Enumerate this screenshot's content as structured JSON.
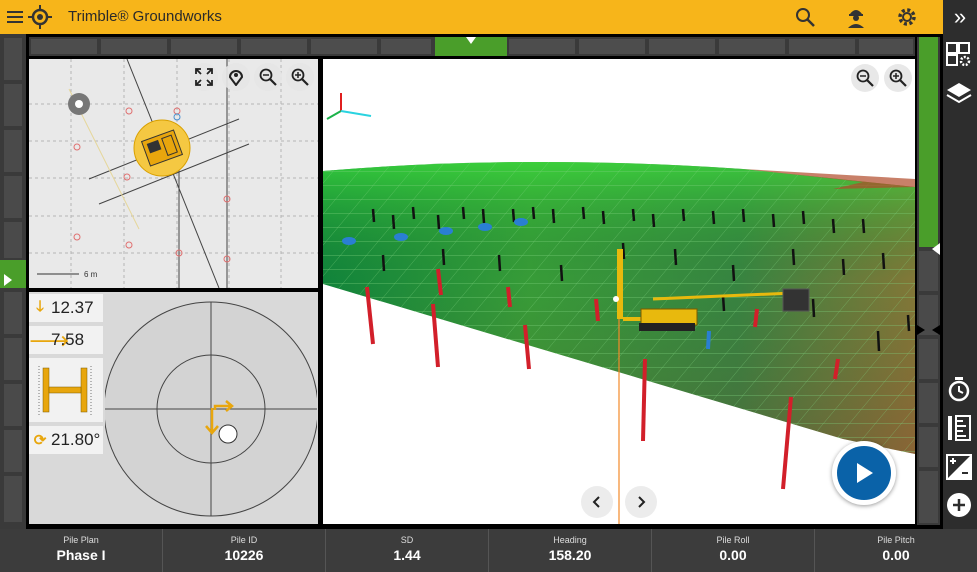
{
  "app": {
    "title": "Trimble® Groundworks"
  },
  "topbar": {
    "menu_icon": "hamburger-icon",
    "logo_icon": "trimble-logo-icon",
    "search_icon": "search-icon",
    "user_icon": "user-icon",
    "settings_icon": "settings-gear-icon",
    "collapse_icon": "double-chevron-right-icon"
  },
  "map_panel": {
    "scale_label": "6 m",
    "tools": [
      "fullscreen-icon",
      "location-pin-icon",
      "zoom-out-icon",
      "zoom-in-icon"
    ]
  },
  "guidance": {
    "cut": {
      "icon": "arrow-down-icon",
      "value": "12.37"
    },
    "offset": {
      "icon": "arrow-right-icon",
      "value": "7.58"
    },
    "rotation": {
      "icon": "rotate-icon",
      "value": "21.80°"
    }
  },
  "view3d": {
    "tools": [
      "zoom-out-icon",
      "zoom-in-icon"
    ],
    "prev_icon": "chevron-left-icon",
    "next_icon": "chevron-right-icon",
    "play_icon": "play-icon"
  },
  "right_toolbar": [
    "layout-settings-icon",
    "layers-icon",
    "timer-icon",
    "measure-icon",
    "surface-edit-icon",
    "add-icon"
  ],
  "status": [
    {
      "label": "Pile Plan",
      "value": "Phase I"
    },
    {
      "label": "Pile ID",
      "value": "10226"
    },
    {
      "label": "SD",
      "value": "1.44"
    },
    {
      "label": "Heading",
      "value": "158.20"
    },
    {
      "label": "Pile Roll",
      "value": "0.00"
    },
    {
      "label": "Pile Pitch",
      "value": "0.00"
    }
  ],
  "colors": {
    "brand": "#f7b51a",
    "rail": "#3a3a3a",
    "accent_blue": "#0a62a8",
    "lightbar_green": "#4a9e2a"
  }
}
